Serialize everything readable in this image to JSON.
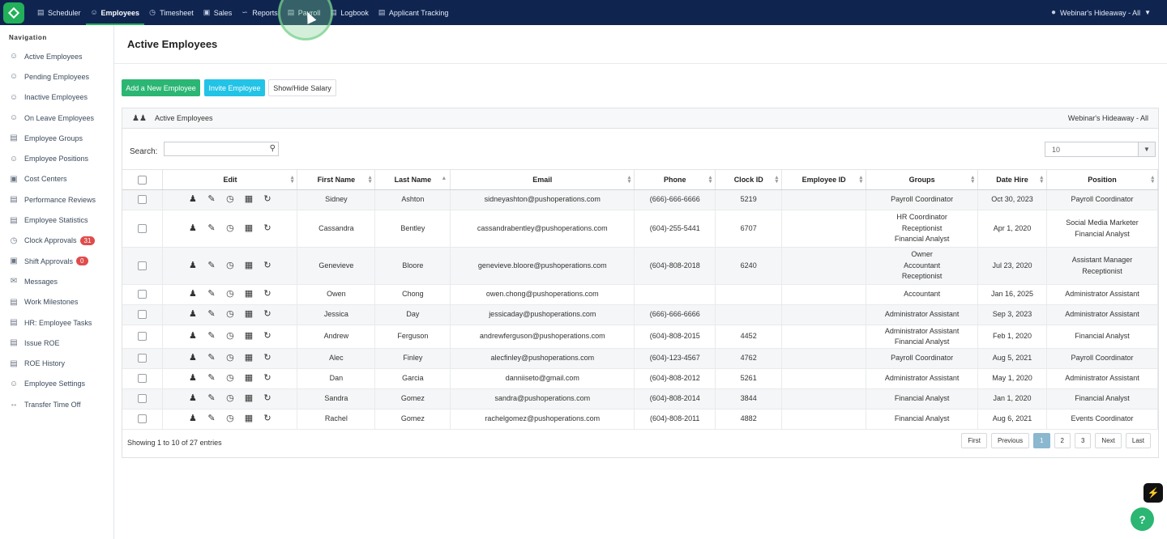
{
  "topnav": {
    "items": [
      {
        "label": "Scheduler",
        "icon": "scheduler-icon"
      },
      {
        "label": "Employees",
        "icon": "user-icon"
      },
      {
        "label": "Timesheet",
        "icon": "clock-icon"
      },
      {
        "label": "Sales",
        "icon": "sales-icon"
      },
      {
        "label": "Reports",
        "icon": "chart-icon"
      },
      {
        "label": "Payroll",
        "icon": "payroll-icon"
      },
      {
        "label": "Logbook",
        "icon": "book-icon"
      },
      {
        "label": "Applicant Tracking",
        "icon": "clipboard-icon"
      }
    ],
    "active": "Employees",
    "location": "Webinar's Hideaway - All"
  },
  "sidebar": {
    "heading": "Navigation",
    "items": [
      {
        "label": "Active Employees"
      },
      {
        "label": "Pending Employees"
      },
      {
        "label": "Inactive Employees"
      },
      {
        "label": "On Leave Employees"
      },
      {
        "label": "Employee Groups"
      },
      {
        "label": "Employee Positions"
      },
      {
        "label": "Cost Centers"
      },
      {
        "label": "Performance Reviews"
      },
      {
        "label": "Employee Statistics"
      },
      {
        "label": "Clock Approvals",
        "badge": "31"
      },
      {
        "label": "Shift Approvals",
        "badge": "0"
      },
      {
        "label": "Messages"
      },
      {
        "label": "Work Milestones"
      },
      {
        "label": "HR: Employee Tasks"
      },
      {
        "label": "Issue ROE"
      },
      {
        "label": "ROE History"
      },
      {
        "label": "Employee Settings"
      },
      {
        "label": "Transfer Time Off"
      }
    ]
  },
  "main": {
    "title": "Active Employees",
    "buttons": {
      "add": "Add a New Employee",
      "invite": "Invite Employee",
      "show_hide": "Show/Hide Salary"
    },
    "panel": {
      "title": "Active Employees",
      "location": "Webinar's Hideaway - All"
    },
    "search_label": "Search:",
    "search_value": "",
    "per_page": "10",
    "columns": [
      "Edit",
      "First Name",
      "Last Name",
      "Email",
      "Phone",
      "Clock ID",
      "Employee ID",
      "Groups",
      "Date Hire",
      "Position"
    ],
    "rows": [
      {
        "first": "Sidney",
        "last": "Ashton",
        "email": "sidneyashton@pushoperations.com",
        "phone": "(666)-666-6666",
        "clock": "5219",
        "empid": "",
        "groups": [
          "Payroll Coordinator"
        ],
        "hire": "Oct 30, 2023",
        "position": [
          "Payroll Coordinator"
        ]
      },
      {
        "first": "Cassandra",
        "last": "Bentley",
        "email": "cassandrabentley@pushoperations.com",
        "phone": "(604)-255-5441",
        "clock": "6707",
        "empid": "",
        "groups": [
          "HR Coordinator",
          "Receptionist",
          "Financial Analyst"
        ],
        "hire": "Apr 1, 2020",
        "position": [
          "Social Media Marketer",
          "Financial Analyst"
        ]
      },
      {
        "first": "Genevieve",
        "last": "Bloore",
        "email": "genevieve.bloore@pushoperations.com",
        "phone": "(604)-808-2018",
        "clock": "6240",
        "empid": "",
        "groups": [
          "Owner",
          "Accountant",
          "Receptionist"
        ],
        "hire": "Jul 23, 2020",
        "position": [
          "Assistant Manager",
          "Receptionist"
        ]
      },
      {
        "first": "Owen",
        "last": "Chong",
        "email": "owen.chong@pushoperations.com",
        "phone": "",
        "clock": "",
        "empid": "",
        "groups": [
          "Accountant"
        ],
        "hire": "Jan 16, 2025",
        "position": [
          "Administrator Assistant"
        ]
      },
      {
        "first": "Jessica",
        "last": "Day",
        "email": "jessicaday@pushoperations.com",
        "phone": "(666)-666-6666",
        "clock": "",
        "empid": "",
        "groups": [
          "Administrator Assistant"
        ],
        "hire": "Sep 3, 2023",
        "position": [
          "Administrator Assistant"
        ]
      },
      {
        "first": "Andrew",
        "last": "Ferguson",
        "email": "andrewferguson@pushoperations.com",
        "phone": "(604)-808-2015",
        "clock": "4452",
        "empid": "",
        "groups": [
          "Administrator Assistant",
          "Financial Analyst"
        ],
        "hire": "Feb 1, 2020",
        "position": [
          "Financial Analyst"
        ]
      },
      {
        "first": "Alec",
        "last": "Finley",
        "email": "alecfinley@pushoperations.com",
        "phone": "(604)-123-4567",
        "clock": "4762",
        "empid": "",
        "groups": [
          "Payroll Coordinator"
        ],
        "hire": "Aug 5, 2021",
        "position": [
          "Payroll Coordinator"
        ]
      },
      {
        "first": "Dan",
        "last": "Garcia",
        "email": "danniiseto@gmail.com",
        "phone": "(604)-808-2012",
        "clock": "5261",
        "empid": "",
        "groups": [
          "Administrator Assistant"
        ],
        "hire": "May 1, 2020",
        "position": [
          "Administrator Assistant"
        ]
      },
      {
        "first": "Sandra",
        "last": "Gomez",
        "email": "sandra@pushoperations.com",
        "phone": "(604)-808-2014",
        "clock": "3844",
        "empid": "",
        "groups": [
          "Financial Analyst"
        ],
        "hire": "Jan 1, 2020",
        "position": [
          "Financial Analyst"
        ]
      },
      {
        "first": "Rachel",
        "last": "Gomez",
        "email": "rachelgomez@pushoperations.com",
        "phone": "(604)-808-2011",
        "clock": "4882",
        "empid": "",
        "groups": [
          "Financial Analyst"
        ],
        "hire": "Aug 6, 2021",
        "position": [
          "Events Coordinator"
        ]
      }
    ],
    "footer_info": "Showing 1 to 10 of 27 entries",
    "pager": [
      "First",
      "Previous",
      "1",
      "2",
      "3",
      "Next",
      "Last"
    ],
    "current_page": "1"
  }
}
